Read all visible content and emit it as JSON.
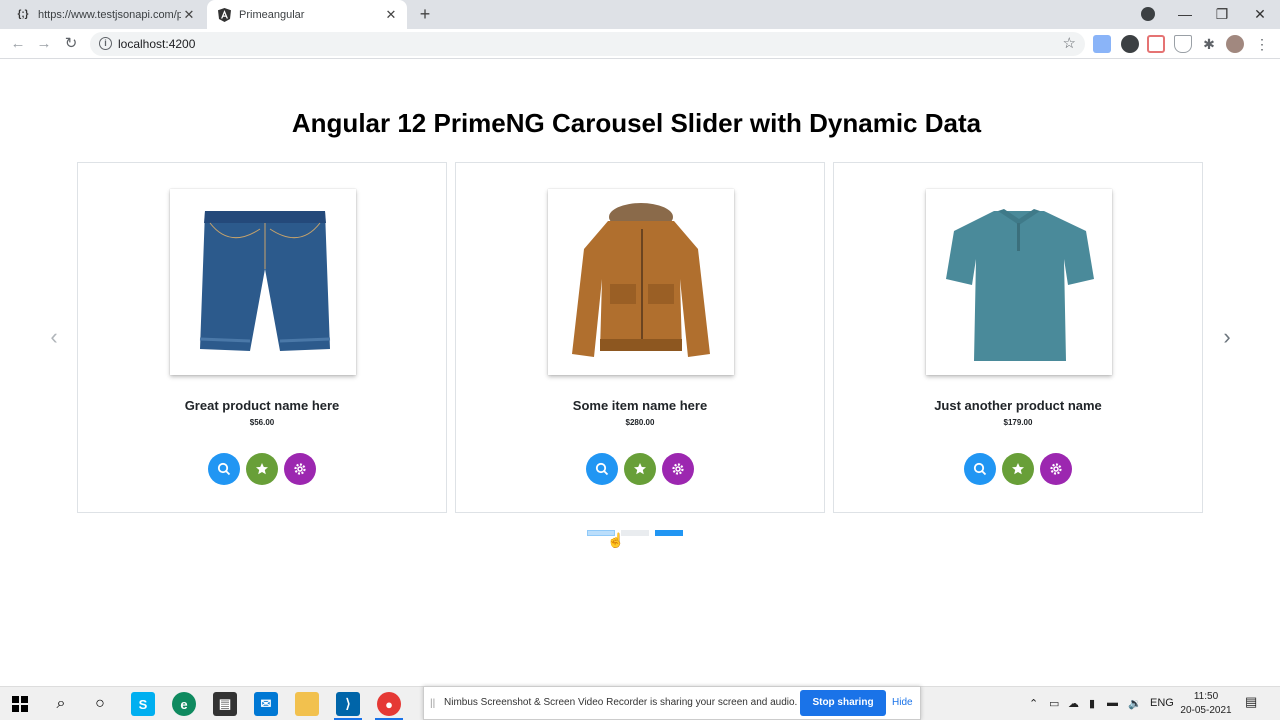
{
  "browser": {
    "tabs": [
      {
        "title": "https://www.testjsonapi.com/pro",
        "favicon": "{;}",
        "active": false
      },
      {
        "title": "Primeangular",
        "favicon": "A",
        "active": true
      }
    ],
    "url": "localhost:4200"
  },
  "page": {
    "heading": "Angular 12 PrimeNG Carousel Slider with Dynamic Data",
    "products": [
      {
        "name": "Great product name here",
        "price": "$56.00",
        "image": "denim-shorts"
      },
      {
        "name": "Some item name here",
        "price": "$280.00",
        "image": "brown-parka-jacket"
      },
      {
        "name": "Just another product name",
        "price": "$179.00",
        "image": "teal-polo-shirt"
      }
    ],
    "carousel": {
      "pages": 3,
      "active_page": 3
    },
    "colors": {
      "search": "#2196f3",
      "favorite": "#689f38",
      "settings": "#9c27b0",
      "indicator_active": "#2196f3"
    }
  },
  "share_banner": {
    "message": "Nimbus Screenshot & Screen Video Recorder is sharing your screen and audio.",
    "stop_label": "Stop sharing",
    "hide_label": "Hide"
  },
  "taskbar": {
    "language": "ENG",
    "time": "11:50",
    "date": "20-05-2021"
  }
}
